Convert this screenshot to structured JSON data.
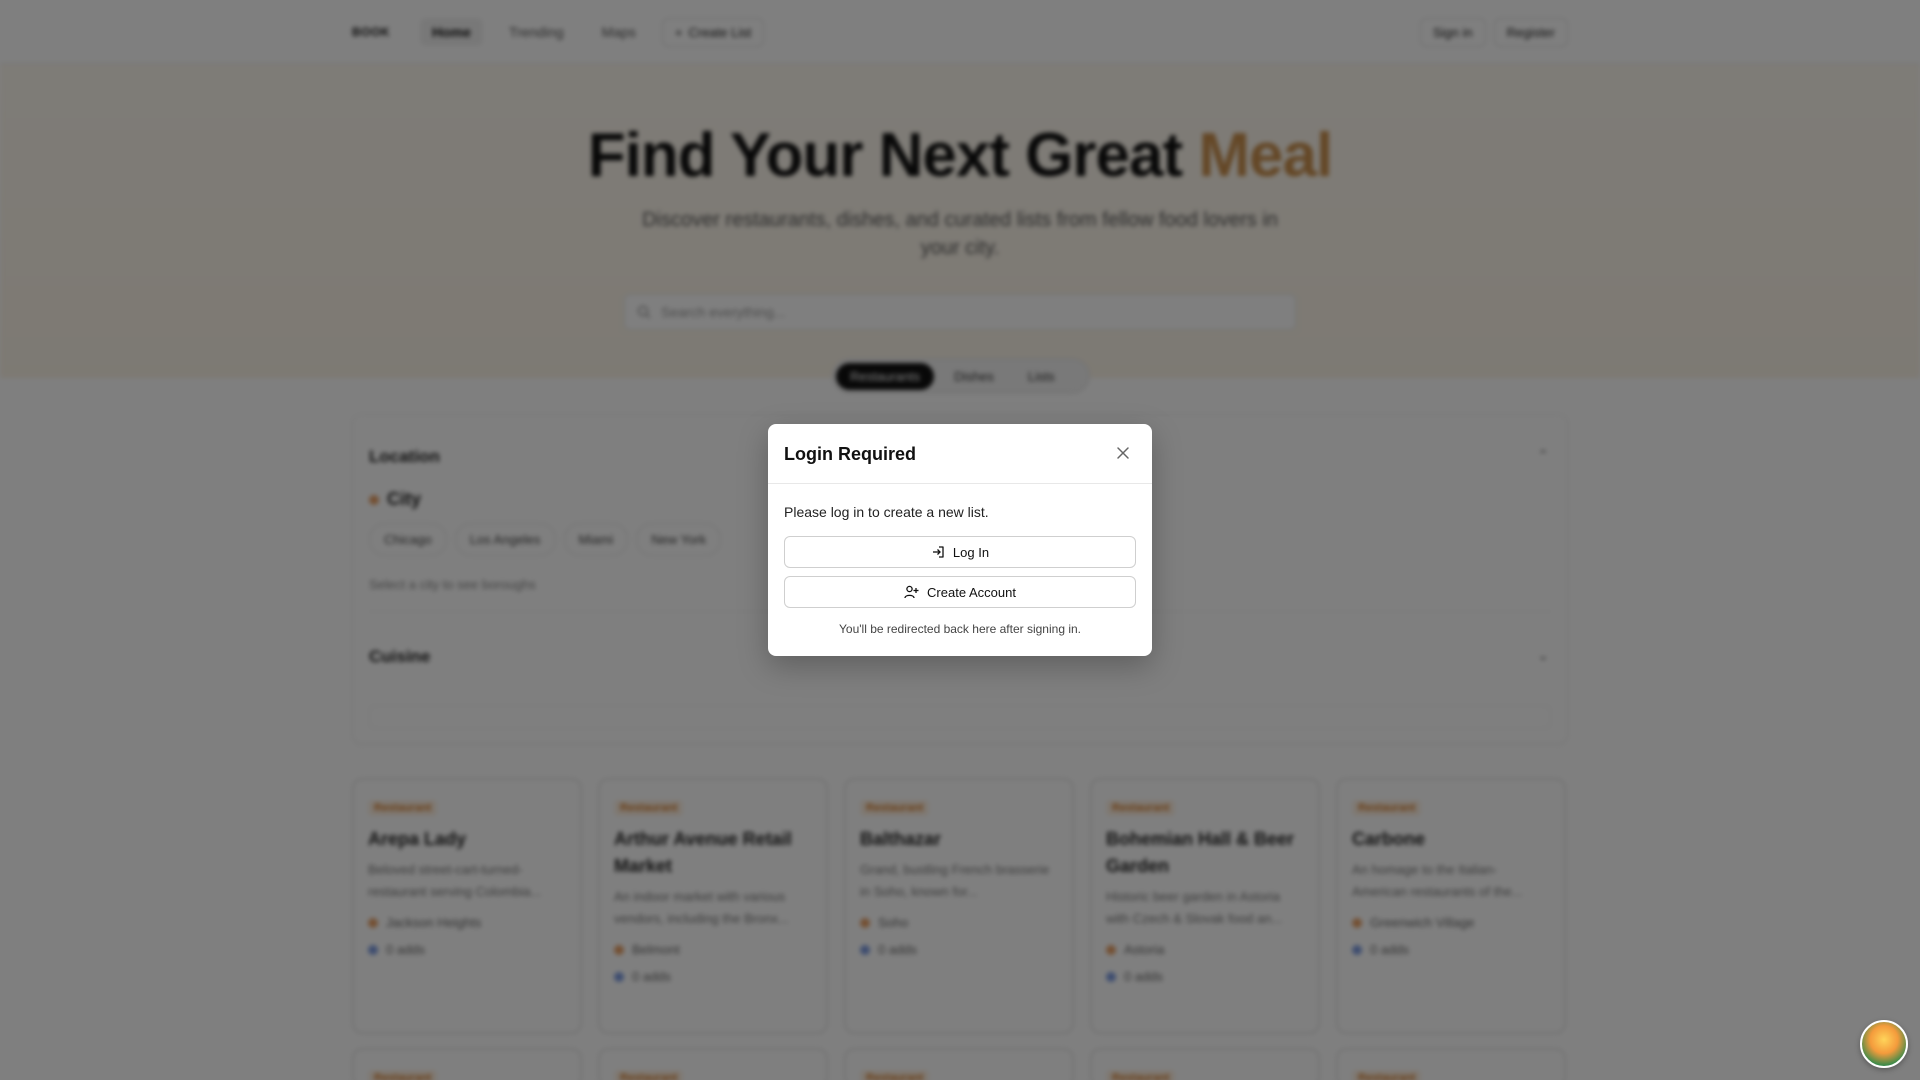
{
  "nav": {
    "logo": "BOOK",
    "links": [
      "Home",
      "Trending",
      "Maps"
    ],
    "create_list": "Create List",
    "sign_in": "Sign in",
    "register": "Register"
  },
  "hero": {
    "title_main": "Find Your Next Great",
    "title_accent": "Meal",
    "subtitle": "Discover restaurants, dishes, and curated lists from fellow food lovers in your city.",
    "search_placeholder": "Search everything...",
    "tabs": [
      "Restaurants",
      "Dishes",
      "Lists"
    ]
  },
  "filters": {
    "location_title": "Location",
    "city_label": "City",
    "cities": [
      "Chicago",
      "Los Angeles",
      "Miami",
      "New York"
    ],
    "hint": "Select a city to see boroughs",
    "cuisine_title": "Cuisine"
  },
  "cards": [
    {
      "badge": "Restaurant",
      "title": "Arepa Lady",
      "desc": "Beloved street-cart-turned-restaurant serving Colombia...",
      "location": "Jackson Heights",
      "adds": "0 adds"
    },
    {
      "badge": "Restaurant",
      "title": "Arthur Avenue Retail Market",
      "desc": "An indoor market with various vendors, including the Bronx...",
      "location": "Belmont",
      "adds": "0 adds"
    },
    {
      "badge": "Restaurant",
      "title": "Balthazar",
      "desc": "Grand, bustling French brasserie in Soho, known for...",
      "location": "Soho",
      "adds": "0 adds"
    },
    {
      "badge": "Restaurant",
      "title": "Bohemian Hall & Beer Garden",
      "desc": "Historic beer garden in Astoria with Czech & Slovak food an...",
      "location": "Astoria",
      "adds": "0 adds"
    },
    {
      "badge": "Restaurant",
      "title": "Carbone",
      "desc": "An homage to the Italian-American restaurants of the...",
      "location": "Greenwich Village",
      "adds": "0 adds"
    }
  ],
  "modal": {
    "title": "Login Required",
    "message": "Please log in to create a new list.",
    "login_label": "Log In",
    "create_label": "Create Account",
    "note": "You'll be redirected back here after signing in."
  }
}
